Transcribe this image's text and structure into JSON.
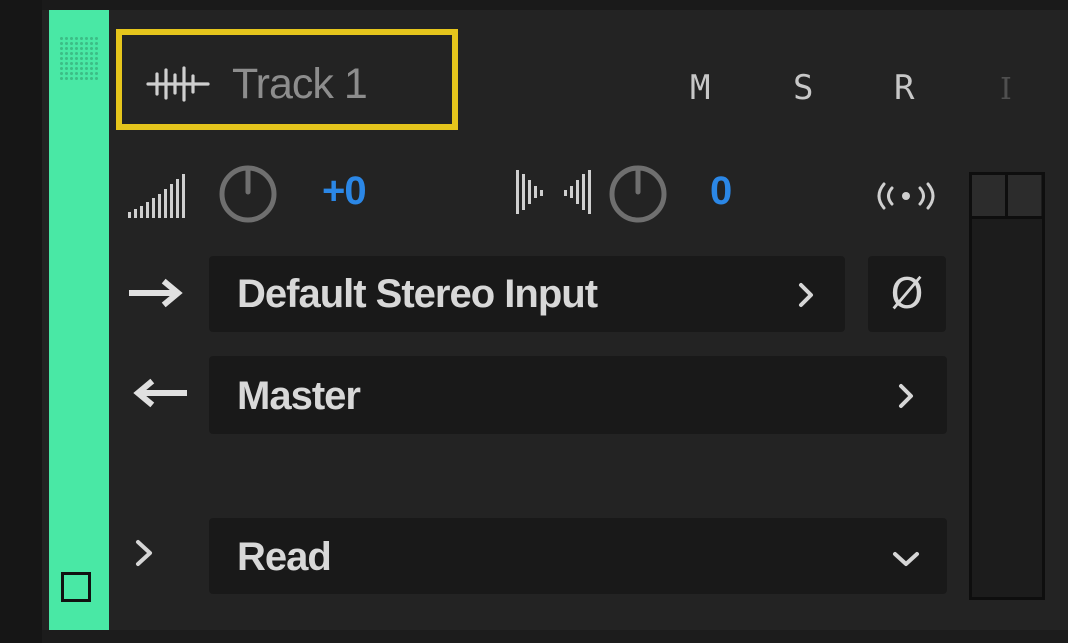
{
  "track": {
    "name": "Track 1",
    "color": "#49e8a5",
    "highlight_color": "#e5c51c"
  },
  "buttons": {
    "mute": "M",
    "solo": "S",
    "record": "R",
    "input_monitor": "I"
  },
  "volume": {
    "icon": "volume-bars-icon",
    "value": "+0"
  },
  "pan": {
    "icon": "pan-bars-icon",
    "value": "0"
  },
  "input": {
    "label": "Default Stereo Input",
    "phase_label": "Ø"
  },
  "output": {
    "label": "Master"
  },
  "automation": {
    "mode": "Read"
  },
  "icons": {
    "waveform": "waveform-icon",
    "input_arrow": "arrow-right-icon",
    "output_arrow": "arrow-left-icon",
    "broadcast": "broadcast-icon",
    "chevron_right": "chevron-right-icon",
    "chevron_down": "chevron-down-icon"
  },
  "colors": {
    "value_blue": "#2b87e6",
    "panel_bg": "#232323",
    "field_bg": "#191919"
  }
}
